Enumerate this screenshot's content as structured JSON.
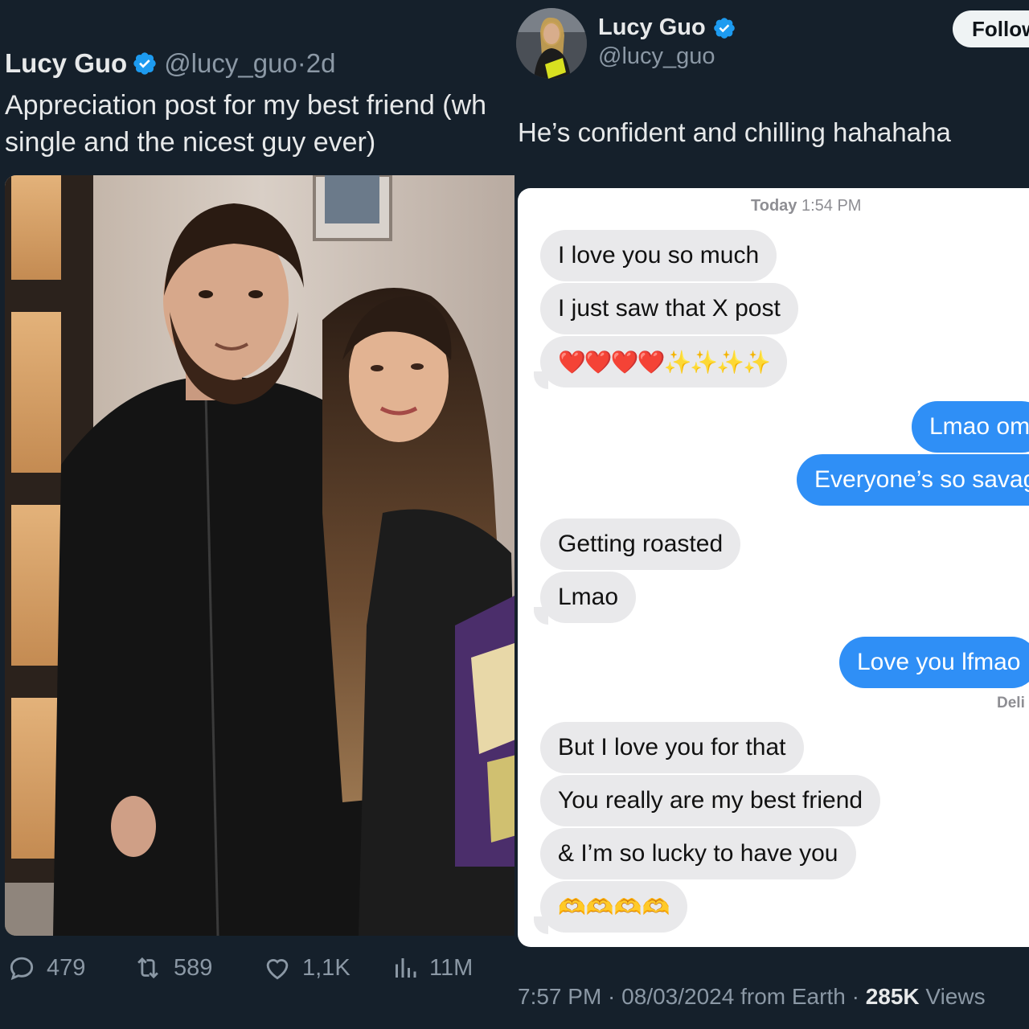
{
  "left_tweet": {
    "author_name": "Lucy Guo",
    "handle": "@lucy_guo",
    "separator": "·",
    "age": "2d",
    "text_line1": "Appreciation post for my best friend (wh",
    "text_line2": "single and the nicest guy ever)",
    "actions": {
      "replies": "479",
      "reposts": "589",
      "likes": "1,1K",
      "views": "11M"
    }
  },
  "right_tweet": {
    "author_name": "Lucy Guo",
    "handle": "@lucy_guo",
    "follow_label": "Follow",
    "text": "He’s confident and chilling hahahaha",
    "chat": {
      "timestamp_day": "Today",
      "timestamp_time": "1:54 PM",
      "messages": [
        {
          "text": "I love you so much",
          "from": "them"
        },
        {
          "text": "I just saw that X post",
          "from": "them"
        },
        {
          "text": "❤️❤️❤️❤️✨✨✨✨",
          "from": "them"
        },
        {
          "text": "Lmao om",
          "from": "me"
        },
        {
          "text": "Everyone’s so savag",
          "from": "me"
        },
        {
          "text": "Getting roasted",
          "from": "them"
        },
        {
          "text": "Lmao",
          "from": "them"
        },
        {
          "text": "Love you lfmao",
          "from": "me"
        },
        {
          "text": "But I love you for that",
          "from": "them"
        },
        {
          "text": "You really are my best friend",
          "from": "them"
        },
        {
          "text": "& I’m so lucky to have you",
          "from": "them"
        },
        {
          "text": "🫶🫶🫶🫶",
          "from": "them"
        }
      ],
      "delivered_label": "Deli"
    },
    "footer": {
      "time": "7:57 PM",
      "date": "08/03/2024",
      "location": "from Earth",
      "views_count": "285K",
      "views_label": "Views"
    }
  },
  "colors": {
    "background": "#15202b",
    "verified": "#1d9bf0",
    "imessage_blue": "#2f8ff6",
    "bubble_gray": "#e9e9eb",
    "muted_text": "#8b98a5"
  },
  "icons": [
    "verified-badge-icon",
    "reply-icon",
    "repost-icon",
    "like-icon",
    "views-icon"
  ]
}
